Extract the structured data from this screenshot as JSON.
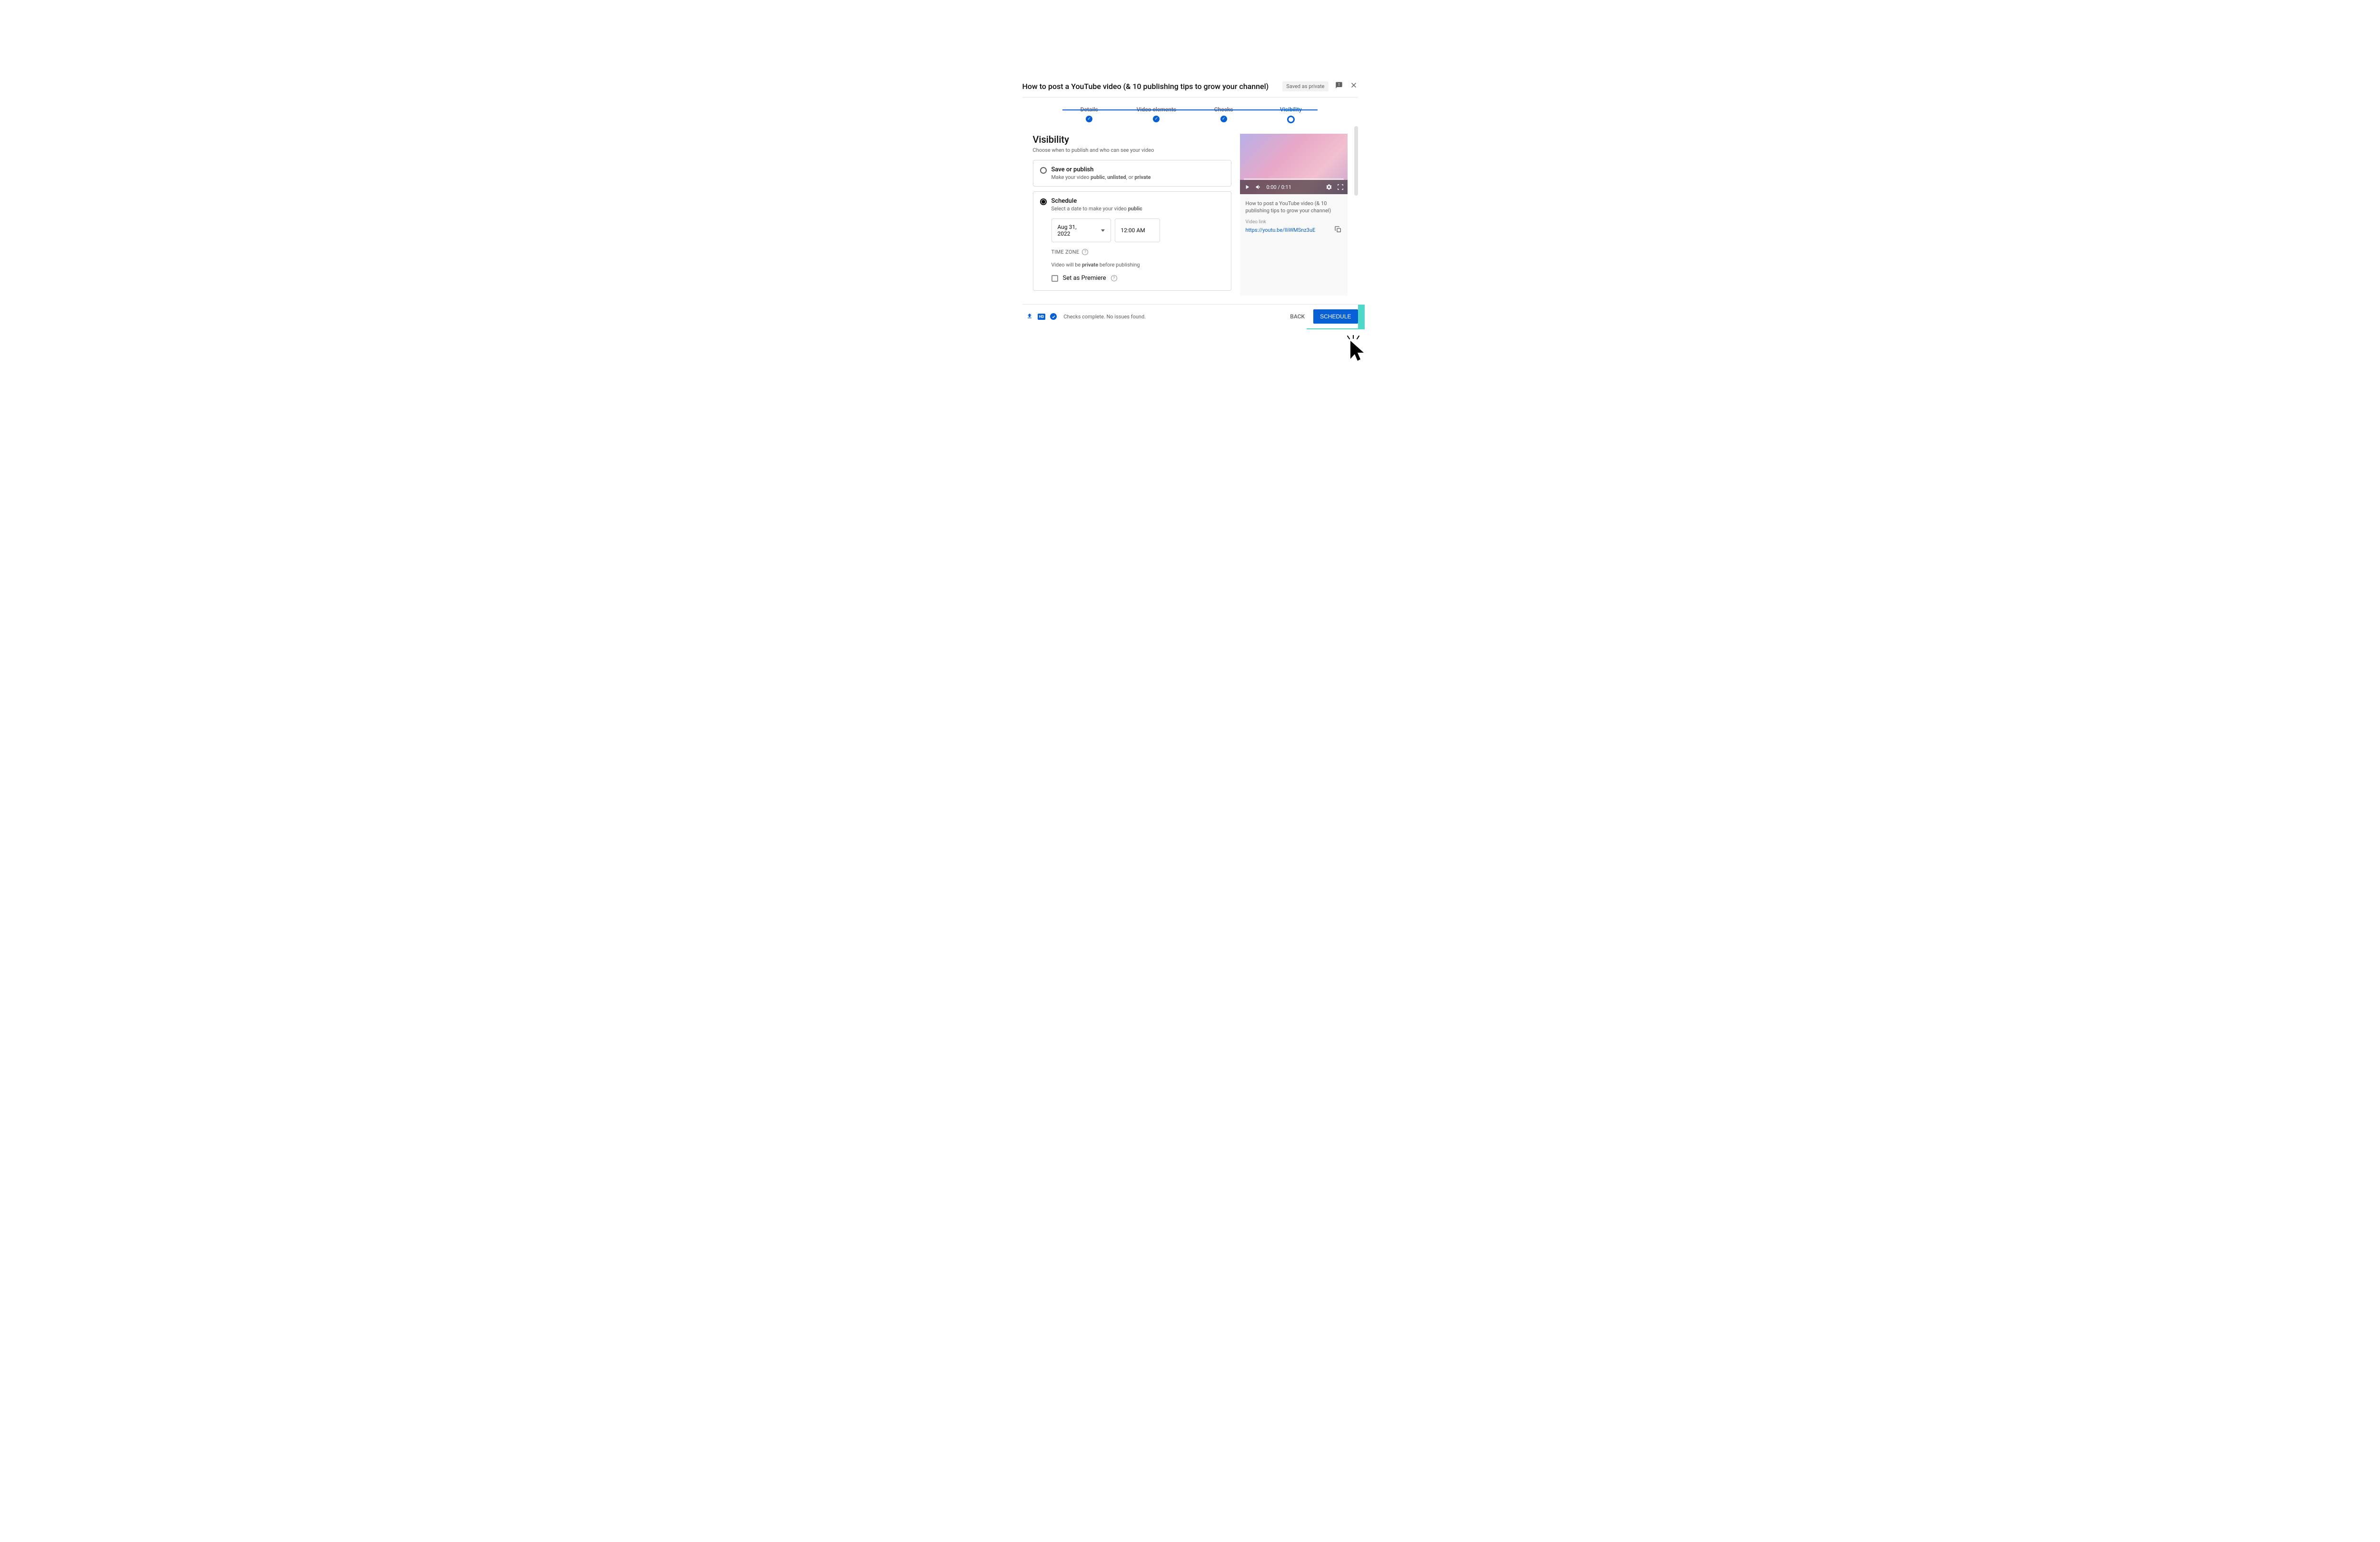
{
  "header": {
    "title": "How to post a YouTube video (& 10 publishing tips to grow your channel)",
    "saved_badge": "Saved as private"
  },
  "stepper": {
    "steps": [
      "Details",
      "Video elements",
      "Checks",
      "Visibility"
    ],
    "active_index": 3
  },
  "visibility": {
    "title": "Visibility",
    "subtitle": "Choose when to publish and who can see your video",
    "save_publish": {
      "label": "Save or publish",
      "desc_prefix": "Make your video ",
      "desc_bold1": "public",
      "desc_sep1": ", ",
      "desc_bold2": "unlisted",
      "desc_sep2": ", or ",
      "desc_bold3": "private"
    },
    "schedule": {
      "label": "Schedule",
      "desc_prefix": "Select a date to make your video ",
      "desc_bold": "public",
      "date": "Aug 31, 2022",
      "time": "12:00 AM",
      "timezone_label": "TIME ZONE",
      "private_prefix": "Video will be ",
      "private_bold": "private",
      "private_suffix": " before publishing",
      "premiere_label": "Set as Premiere"
    }
  },
  "preview": {
    "time": "0:00 / 0:11",
    "title": "How to post a YouTube video (& 10 publishing tips to grow your channel)",
    "link_label": "Video link",
    "link": "https://youtu.be/IIiWMSnz3uE"
  },
  "footer": {
    "status": "Checks complete. No issues found.",
    "back": "BACK",
    "schedule": "SCHEDULE"
  }
}
